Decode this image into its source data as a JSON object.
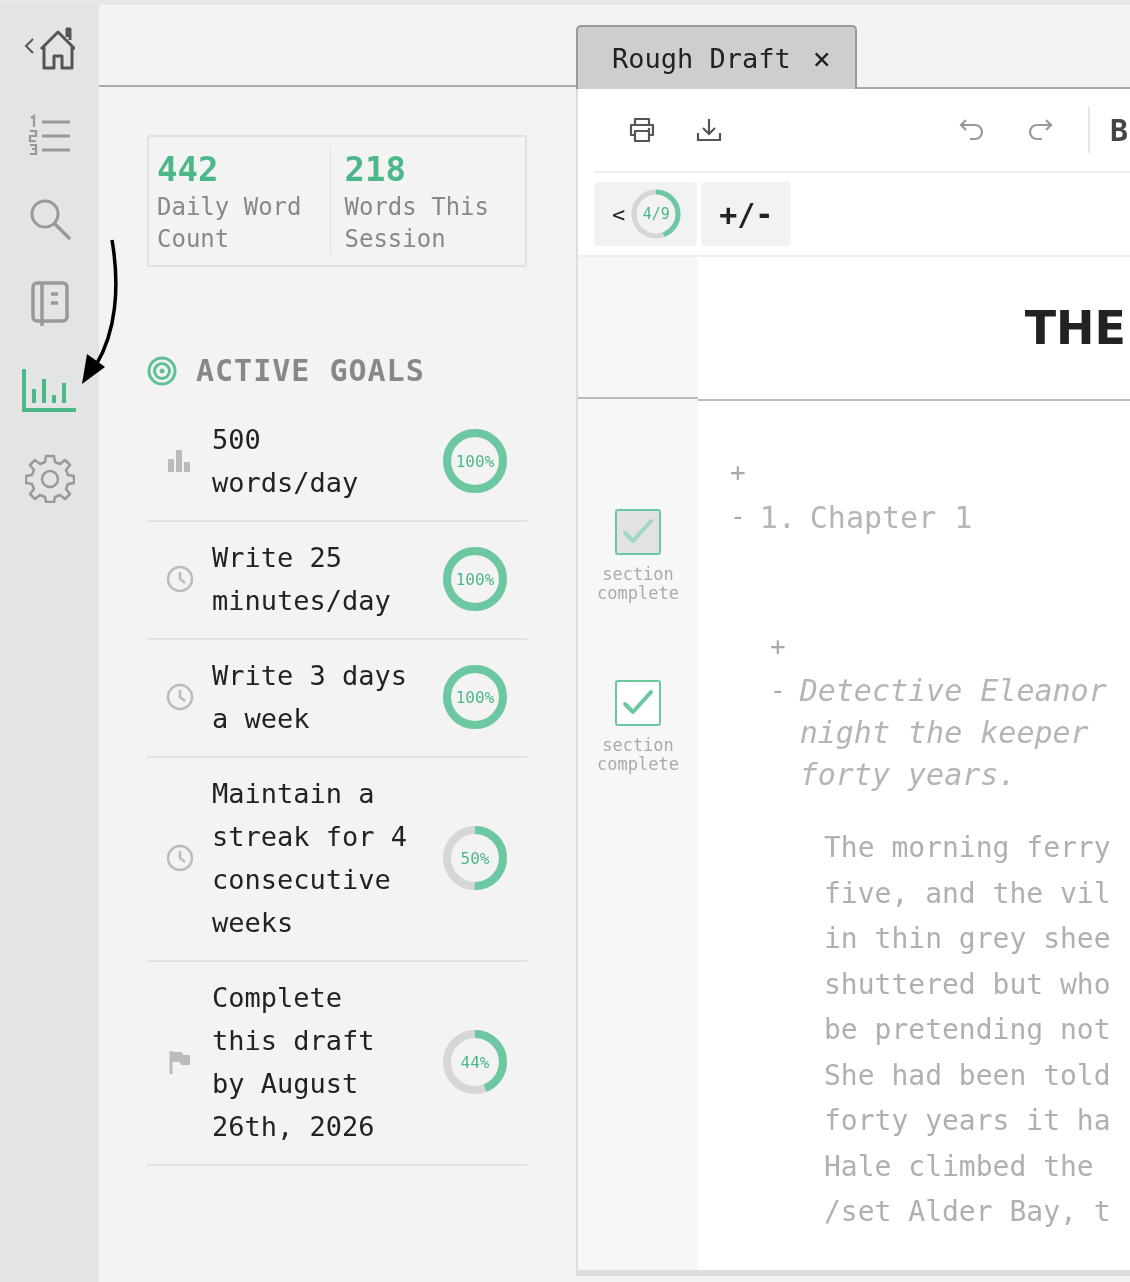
{
  "sidebar": {
    "items": [
      {
        "selected": false
      },
      {
        "selected": false
      },
      {
        "selected": false
      },
      {
        "selected": false
      },
      {
        "selected": true
      },
      {
        "selected": false
      }
    ]
  },
  "stats": [
    {
      "value": "442",
      "label": "Daily Word Count"
    },
    {
      "value": "218",
      "label": "Words This Session"
    }
  ],
  "goals_header": "ACTIVE GOALS",
  "goals": [
    {
      "text": "500 words/day",
      "percent": "100%",
      "level": 1
    },
    {
      "text": "Write 25 minutes/day",
      "percent": "100%",
      "level": 1
    },
    {
      "text": "Write 3 days a week",
      "percent": "100%",
      "level": 1
    },
    {
      "text": "Maintain a streak for 4 consecutive weeks",
      "percent": "50%",
      "level": 0.5
    },
    {
      "text": "Complete this draft by August 26th, 2026",
      "percent": "44%",
      "level": 0.44
    }
  ],
  "tabs": [
    {
      "label": "Rough Draft",
      "close": "×",
      "selected": true
    }
  ],
  "toolbar": {
    "bold": "B"
  },
  "nav": {
    "back": "<",
    "progress": "4/9",
    "level": 0.44,
    "toggle": "+/-"
  },
  "document": {
    "title": "THE",
    "sections": [
      {
        "checked": true,
        "disabled": true,
        "status": "section complete",
        "add": "+",
        "collapse": "-",
        "number": "1.",
        "heading": "Chapter 1"
      },
      {
        "checked": true,
        "disabled": false,
        "status": "section complete",
        "add": "+",
        "collapse": "-",
        "summary": [
          "Detective Eleanor",
          "night the keeper",
          "forty years."
        ]
      }
    ],
    "paragraph": [
      "The morning ferry",
      "five, and the vil",
      "in thin grey shee",
      "shuttered but who",
      "be pretending not",
      "She had been told",
      "forty years it ha",
      "Hale climbed the",
      "/set Alder Bay, t"
    ]
  }
}
